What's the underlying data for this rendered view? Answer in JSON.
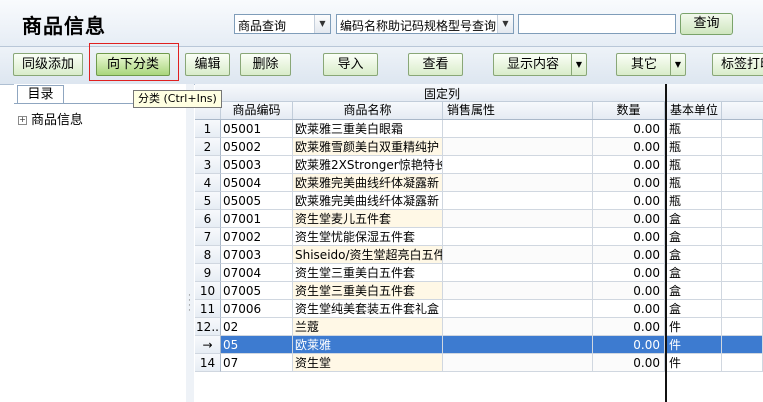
{
  "header": {
    "title": "商品信息",
    "query_type": "商品查询",
    "query_field": "编码名称助记码规格型号查询",
    "search_value": "",
    "search_button": "查询"
  },
  "toolbar": {
    "buttons": [
      "同级添加",
      "向下分类",
      "编辑",
      "删除",
      "导入",
      "查看",
      "显示内容",
      "其它",
      "标签打印"
    ],
    "tooltip": "分类 (Ctrl+Ins)"
  },
  "left_panel": {
    "tab": "目录",
    "tree": [
      {
        "label": "商品信息"
      }
    ]
  },
  "grid": {
    "group_label": "固定列",
    "columns": [
      "商品编码",
      "商品名称",
      "销售属性",
      "数量",
      "基本单位"
    ],
    "rows": [
      {
        "num": "1",
        "code": "05001",
        "name": "欧莱雅三重美白眼霜",
        "attr": "",
        "qty": "0.00",
        "unit": "瓶"
      },
      {
        "num": "2",
        "code": "05002",
        "name": "欧莱雅雪颜美白双重精纯护",
        "attr": "",
        "qty": "0.00",
        "unit": "瓶"
      },
      {
        "num": "3",
        "code": "05003",
        "name": "欧莱雅2XStronger惊艳特长",
        "attr": "",
        "qty": "0.00",
        "unit": "瓶"
      },
      {
        "num": "4",
        "code": "05004",
        "name": "欧莱雅完美曲线纤体凝露新",
        "attr": "",
        "qty": "0.00",
        "unit": "瓶"
      },
      {
        "num": "5",
        "code": "05005",
        "name": "欧莱雅完美曲线纤体凝露新",
        "attr": "",
        "qty": "0.00",
        "unit": "瓶"
      },
      {
        "num": "6",
        "code": "07001",
        "name": "资生堂麦儿五件套",
        "attr": "",
        "qty": "0.00",
        "unit": "盒"
      },
      {
        "num": "7",
        "code": "07002",
        "name": "资生堂忧能保湿五件套",
        "attr": "",
        "qty": "0.00",
        "unit": "盒"
      },
      {
        "num": "8",
        "code": "07003",
        "name": "Shiseido/资生堂超亮白五件",
        "attr": "",
        "qty": "0.00",
        "unit": "盒"
      },
      {
        "num": "9",
        "code": "07004",
        "name": "资生堂三重美白五件套",
        "attr": "",
        "qty": "0.00",
        "unit": "盒"
      },
      {
        "num": "10",
        "code": "07005",
        "name": "资生堂三重美白五件套",
        "attr": "",
        "qty": "0.00",
        "unit": "盒"
      },
      {
        "num": "11",
        "code": "07006",
        "name": "资生堂纯美套装五件套礼盒",
        "attr": "",
        "qty": "0.00",
        "unit": "盒"
      },
      {
        "num": "12..",
        "code": "02",
        "name": "兰蔻",
        "attr": "",
        "qty": "0.00",
        "unit": "件"
      },
      {
        "num": "→",
        "code": "05",
        "name": "欧莱雅",
        "attr": "",
        "qty": "0.00",
        "unit": "件",
        "selected": true
      },
      {
        "num": "14",
        "code": "07",
        "name": "资生堂",
        "attr": "",
        "qty": "0.00",
        "unit": "件"
      }
    ]
  },
  "icons": {
    "dropdown": "chevron-down-icon",
    "tree_expand": "plus-box-icon"
  },
  "colors": {
    "selection": "#3d7bd0",
    "button_green": "#d9ecca",
    "highlight_border": "#e02020",
    "tooltip_bg": "#ffffe1"
  }
}
